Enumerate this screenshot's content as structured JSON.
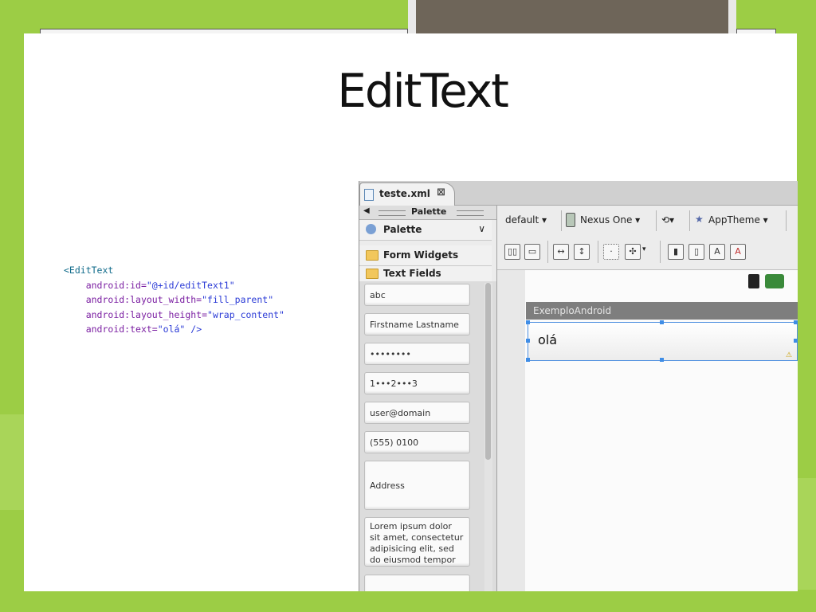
{
  "slide": {
    "title": "EditText"
  },
  "code": {
    "line1": "<EditText",
    "line2_attr": "android:id=",
    "line2_val": "\"@+id/editText1\"",
    "line3_attr": "android:layout_width=",
    "line3_val": "\"fill_parent\"",
    "line4_attr": "android:layout_height=",
    "line4_val": "\"wrap_content\"",
    "line5_attr": "android:text=",
    "line5_val": "\"olá\"",
    "line5_end": " />"
  },
  "editor": {
    "tab_label": "teste.xml",
    "tab_close": "⊠"
  },
  "palette": {
    "header": "Palette",
    "dropdown_label": "Palette",
    "sections": [
      "Form Widgets",
      "Text Fields"
    ],
    "widgets": [
      "abc",
      "Firstname Lastname",
      "••••••••",
      "1•••2•••3",
      "user@domain",
      "(555) 0100",
      "Address",
      "Lorem ipsum dolor sit amet, consectetur adipisicing elit, sed do eiusmod tempor"
    ]
  },
  "toolbar": {
    "config": "default",
    "device": "Nexus One",
    "theme": "AppTheme"
  },
  "canvas": {
    "app_title": "ExemploAndroid",
    "edit_text_value": "olá"
  },
  "colors": {
    "background_green": "#9ccd45",
    "selection_blue": "#3f8de6",
    "action_bar": "#7e7e7e"
  }
}
